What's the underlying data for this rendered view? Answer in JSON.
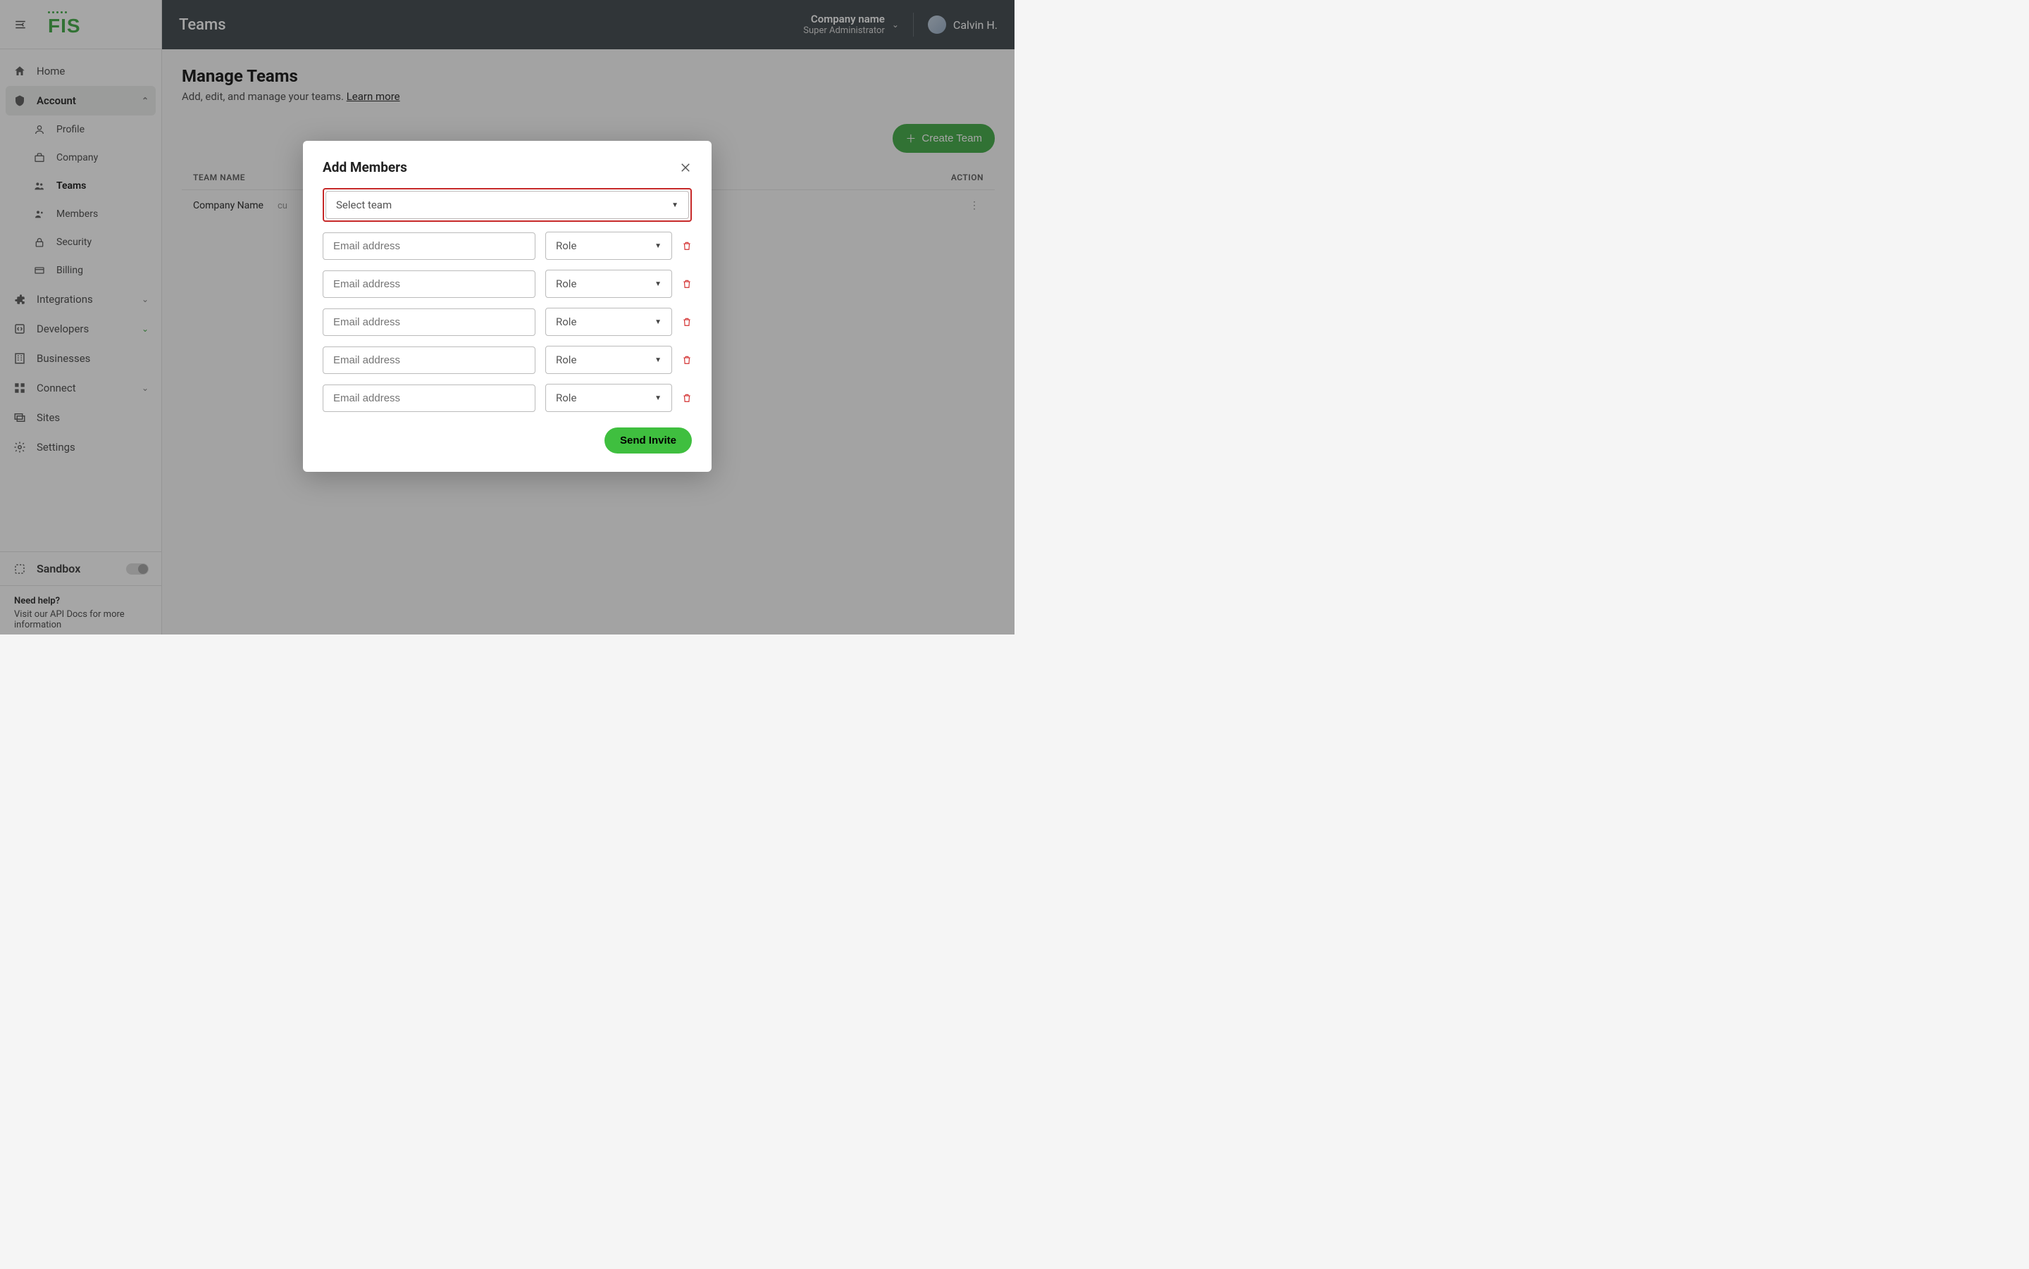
{
  "logo": "FIS",
  "header": {
    "title": "Teams",
    "company_name": "Company name",
    "company_role": "Super Administrator",
    "user_name": "Calvin H."
  },
  "sidebar": {
    "items": [
      {
        "label": "Home"
      },
      {
        "label": "Account"
      },
      {
        "label": "Integrations"
      },
      {
        "label": "Developers"
      },
      {
        "label": "Businesses"
      },
      {
        "label": "Connect"
      },
      {
        "label": "Sites"
      },
      {
        "label": "Settings"
      }
    ],
    "account_sub": [
      {
        "label": "Profile"
      },
      {
        "label": "Company"
      },
      {
        "label": "Teams"
      },
      {
        "label": "Members"
      },
      {
        "label": "Security"
      },
      {
        "label": "Billing"
      }
    ],
    "sandbox_label": "Sandbox",
    "help_title": "Need help?",
    "help_text": "Visit our API Docs for more information"
  },
  "page": {
    "title": "Manage Teams",
    "subtitle_prefix": "Add, edit, and manage your teams. ",
    "learn_more": "Learn more",
    "create_button": "Create Team",
    "col_team_name": "TEAM NAME",
    "col_action": "ACTION",
    "row_team": "Company Name",
    "row_sub": "cu"
  },
  "modal": {
    "title": "Add Members",
    "select_team_placeholder": "Select team",
    "email_placeholder": "Email address",
    "role_placeholder": "Role",
    "send_button": "Send Invite"
  }
}
